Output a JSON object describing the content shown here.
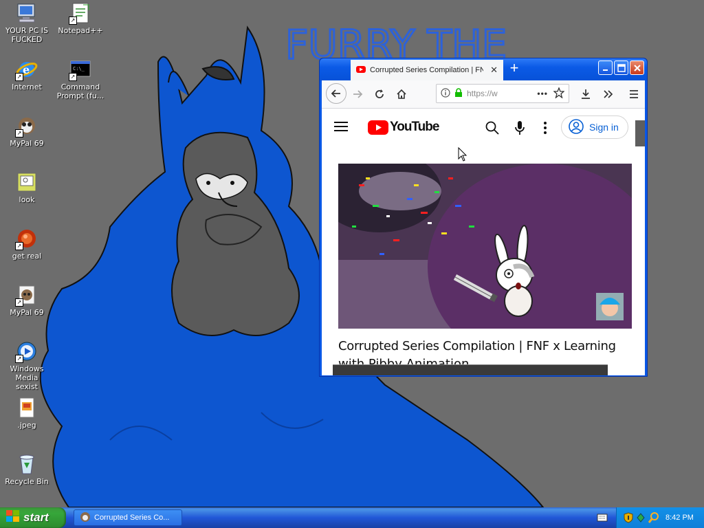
{
  "desktop": {
    "icons": [
      {
        "label": "YOUR PC IS\nFUCKED",
        "icon": "my-computer-icon"
      },
      {
        "label": "Notepad++",
        "icon": "notepad-plus-plus-icon"
      },
      {
        "label": "Internet",
        "icon": "internet-explorer-icon"
      },
      {
        "label": "Command\nPrompt (fu...",
        "icon": "command-prompt-icon"
      },
      {
        "label": "MyPal 69",
        "icon": "mypal-icon"
      },
      {
        "label": "look",
        "icon": "look-icon"
      },
      {
        "label": "get real",
        "icon": "get-real-icon"
      },
      {
        "label": "MyPal 69",
        "icon": "mypal-icon"
      },
      {
        "label": "Windows Media\nsexist",
        "icon": "windows-media-icon"
      },
      {
        "label": ".jpeg",
        "icon": "jpeg-file-icon"
      },
      {
        "label": "Recycle Bin",
        "icon": "recycle-bin-icon"
      }
    ],
    "wallpaper_text": "FURRY THE"
  },
  "browser": {
    "tab_title": "Corrupted Series Compilation | FNF",
    "url": "https://w",
    "page": {
      "site": "YouTube",
      "signin_label": "Sign in",
      "video_title": "Corrupted Series Compilation | FNF x Learning",
      "video_title_line2": "with Pibby Animation"
    }
  },
  "taskbar": {
    "start_label": "start",
    "task_label": "Corrupted Series Co...",
    "clock": "8:42 PM"
  },
  "colors": {
    "taskbar_blue": "#245edb",
    "start_green": "#36a63a",
    "youtube_red": "#ff0000",
    "signin_blue": "#065fd4"
  }
}
